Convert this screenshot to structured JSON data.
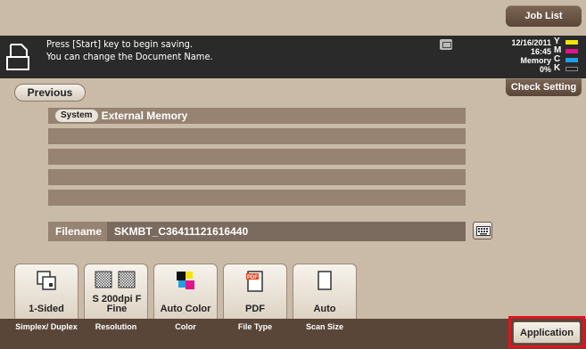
{
  "header": {
    "job_list_label": "Job List"
  },
  "message": {
    "line1": "Press [Start] key to begin saving.",
    "line2": "You can change the Document Name."
  },
  "status": {
    "date": "12/16/2011",
    "time": "16:45",
    "memory_label": "Memory",
    "memory_value": "0%",
    "toner": [
      {
        "letter": "Y",
        "color": "#f5e400"
      },
      {
        "letter": "M",
        "color": "#e0148c"
      },
      {
        "letter": "C",
        "color": "#1ea0e6"
      },
      {
        "letter": "K",
        "color": "#222222"
      }
    ]
  },
  "nav": {
    "previous_label": "Previous",
    "check_setting_label": "Check Setting"
  },
  "destination": {
    "badge": "System",
    "name": "External Memory"
  },
  "filename": {
    "label": "Filename",
    "value": "SKMBT_C36411121616440"
  },
  "settings": [
    {
      "value": "1-Sided",
      "caption": "Simplex/ Duplex",
      "icon": "simplex-icon"
    },
    {
      "value": "S 200dpi F Fine",
      "caption": "Resolution",
      "icon": "resolution-icon"
    },
    {
      "value": "Auto Color",
      "caption": "Color",
      "icon": "color-icon"
    },
    {
      "value": "PDF",
      "caption": "File Type",
      "icon": "pdf-icon",
      "icon_text": "PDF"
    },
    {
      "value": "Auto",
      "caption": "Scan Size",
      "icon": "scan-size-icon"
    }
  ],
  "application_label": "Application",
  "colors": {
    "accent_highlight": "#e0141e",
    "panel_bg": "#c9bba7",
    "dark_brown": "#5a4638"
  }
}
